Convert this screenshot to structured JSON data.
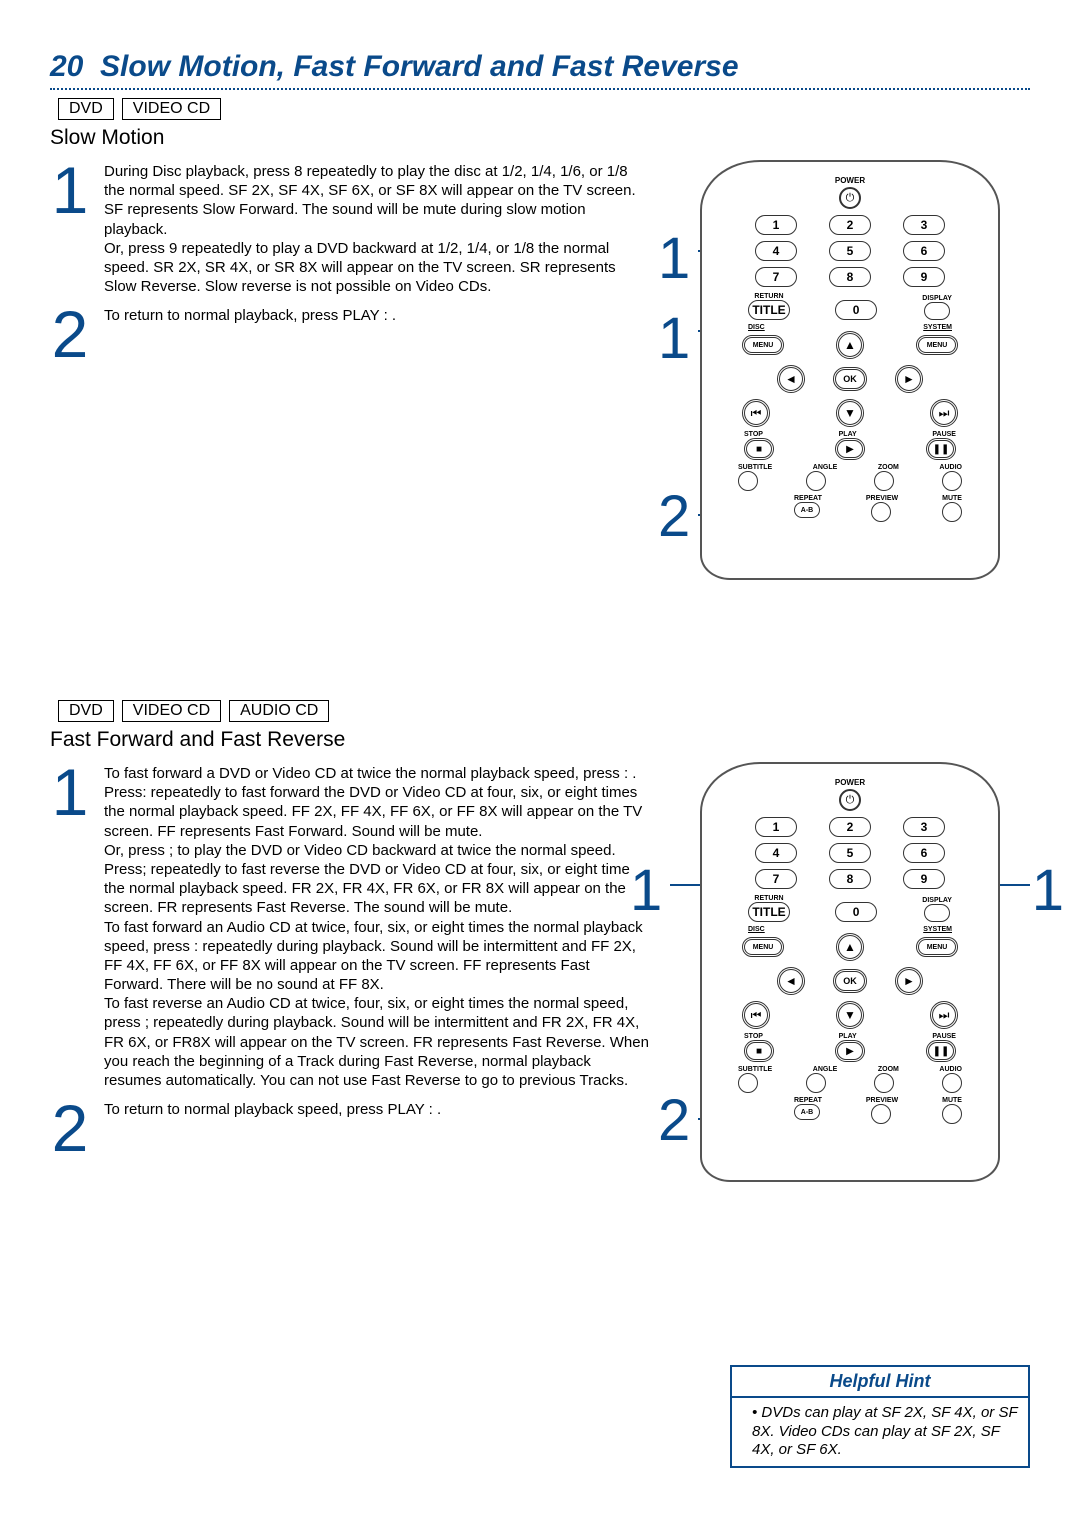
{
  "page": {
    "number": "20",
    "title": "Slow Motion, Fast Forward and Fast Reverse"
  },
  "slow_motion": {
    "badges": [
      "DVD",
      "VIDEO CD"
    ],
    "heading": "Slow Motion",
    "steps": {
      "s1_num": "1",
      "s1_text": "During Disc playback, press  8  repeatedly to play the disc at 1/2, 1/4, 1/6, or 1/8 the normal speed.  SF 2X, SF 4X, SF 6X, or SF 8X will appear on the TV screen. SF represents Slow Forward. The sound will be mute during slow motion playback.\nOr, press  9  repeatedly to play a DVD backward at 1/2, 1/4, or 1/8 the normal speed.  SR 2X, SR 4X, or SR 8X will appear on the TV screen. SR represents Slow Reverse. Slow reverse is not possible on Video CDs.",
      "s2_num": "2",
      "s2_text": "To return to normal playback, press PLAY  :  ."
    },
    "callouts": {
      "c1": "1",
      "c1b": "1",
      "c2": "2"
    }
  },
  "fast": {
    "badges": [
      "DVD",
      "VIDEO CD",
      "AUDIO CD"
    ],
    "heading": "Fast Forward and Fast Reverse",
    "steps": {
      "s1_num": "1",
      "s1_text": "To fast forward a DVD or Video CD at twice the normal playback speed, press  :  . Press:   repeatedly to fast forward the DVD or Video CD at four, six, or eight times the normal playback speed. FF 2X, FF 4X, FF 6X, or FF 8X will appear on the TV screen. FF represents Fast Forward. Sound will be mute.\nOr, press  ;  to play the DVD or Video CD backward at twice the normal speed.   Press;  repeatedly to fast reverse the DVD or Video CD at four, six, or eight times the normal playback speed. FR 2X, FR 4X, FR 6X, or FR 8X will appear on the TV screen. FR represents Fast Reverse. The sound will be mute.\nTo fast forward an Audio CD at twice, four, six, or eight times the normal playback speed, press   :   repeatedly during playback.  Sound will be intermittent and FF 2X, FF 4X, FF 6X, or FF 8X will appear on the TV screen. FF represents Fast Forward. There will be no sound at FF 8X.\nTo fast reverse an Audio CD at twice, four, six, or eight times the normal speed, press   ;   repeatedly during playback. Sound will be intermittent and FR 2X, FR 4X, FR 6X, or FR8X will appear on the TV screen. FR represents Fast Reverse. When you reach the beginning of a Track during Fast Reverse, normal playback resumes automatically. You can not use Fast Reverse to go to previous Tracks.",
      "s2_num": "2",
      "s2_text": "To return to normal playback speed, press PLAY   :  ."
    },
    "callouts": {
      "c1_left": "1",
      "c1_right": "1",
      "c2": "2"
    }
  },
  "remote": {
    "power_label": "POWER",
    "numbers": [
      "1",
      "2",
      "3",
      "4",
      "5",
      "6",
      "7",
      "8",
      "9"
    ],
    "return_label": "RETURN",
    "title_label": "TITLE",
    "zero": "0",
    "display_label": "DISPLAY",
    "disc_label": "DISC",
    "system_label": "SYSTEM",
    "menu_label": "MENU",
    "ok_label": "OK",
    "stop_label": "STOP",
    "play_label": "PLAY",
    "pause_label": "PAUSE",
    "subtitle_label": "SUBTITLE",
    "angle_label": "ANGLE",
    "zoom_label": "ZOOM",
    "audio_label": "AUDIO",
    "repeat_label": "REPEAT",
    "preview_label": "PREVIEW",
    "mute_label": "MUTE",
    "ab_label": "A-B"
  },
  "hint": {
    "title": "Helpful Hint",
    "item": "DVDs can play at SF 2X, SF 4X, or SF 8X. Video CDs can play at SF 2X, SF 4X, or SF 6X."
  }
}
